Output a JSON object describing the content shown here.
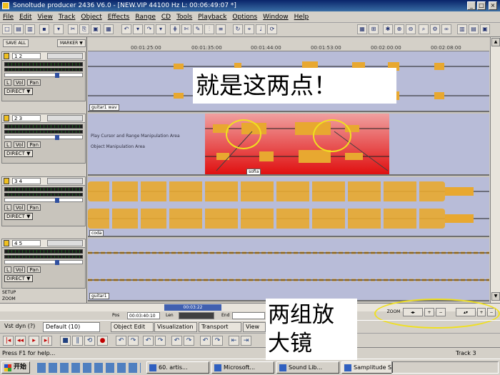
{
  "window": {
    "title": "Sonoltude producer 2436 V6.0 - [NEW.VIP  44100 Hz  L: 00:06:49:07 *]",
    "buttons": [
      "_",
      "□",
      "×"
    ]
  },
  "menu": [
    "File",
    "Edit",
    "View",
    "Track",
    "Object",
    "Effects",
    "Range",
    "CD",
    "Tools",
    "Playback",
    "Options",
    "Window",
    "Help"
  ],
  "left_top_buttons": {
    "a": "SAVE ALL",
    "b": "MARKER ▼"
  },
  "ruler": {
    "ticks": [
      "00:01:25:00",
      "00:01:35:00",
      "00:01:44:00",
      "00:01:53:00",
      "00:02:00:00",
      "00:02:08:00"
    ]
  },
  "tracks": [
    {
      "name": "1 2",
      "clip": "guitar1 wav",
      "buttons": [
        "L",
        "Vol",
        "Pan"
      ],
      "direct": "DIRECT ▼"
    },
    {
      "name": "2 3",
      "clip": "sofia",
      "buttons": [
        "L",
        "Vol",
        "Pan"
      ],
      "direct": "DIRECT ▼",
      "guide1": "Play Cursor and Range Manipulation Area",
      "guide2": "Object Manipulation Area"
    },
    {
      "name": "3 4",
      "clip": "coda",
      "buttons": [
        "L",
        "Vol",
        "Pan"
      ],
      "direct": "DIRECT ▼"
    },
    {
      "name": "4 5",
      "clip": "guitar1",
      "buttons": [
        "L",
        "Vol",
        "Pan"
      ],
      "direct": "DIRECT ▼"
    }
  ],
  "setup": {
    "label1": "SETUP",
    "label2": "ZOOM",
    "range_field": "00:03:22"
  },
  "timebar": {
    "pos_label": "Pos",
    "pos_value": "00:03:40:10",
    "len_label": "Len",
    "end_label": "End"
  },
  "transport": {
    "label": "Vst dyn (?)",
    "preset": "Default (10)",
    "tabs": [
      "Object Edit",
      "Visualization",
      "Transport",
      "View"
    ]
  },
  "zoom_label": "ZOOM",
  "status": {
    "left": "Press F1 for help...",
    "right": "Track 3"
  },
  "taskbar": {
    "start": "开始",
    "items": [
      "60. artis...",
      "Microsoft...",
      "Sound Lib...",
      "Samplitude S..."
    ]
  },
  "annotations": {
    "callout1": "就是这两点！",
    "callout2_line1": "两组放",
    "callout2_line2": "大镜"
  }
}
